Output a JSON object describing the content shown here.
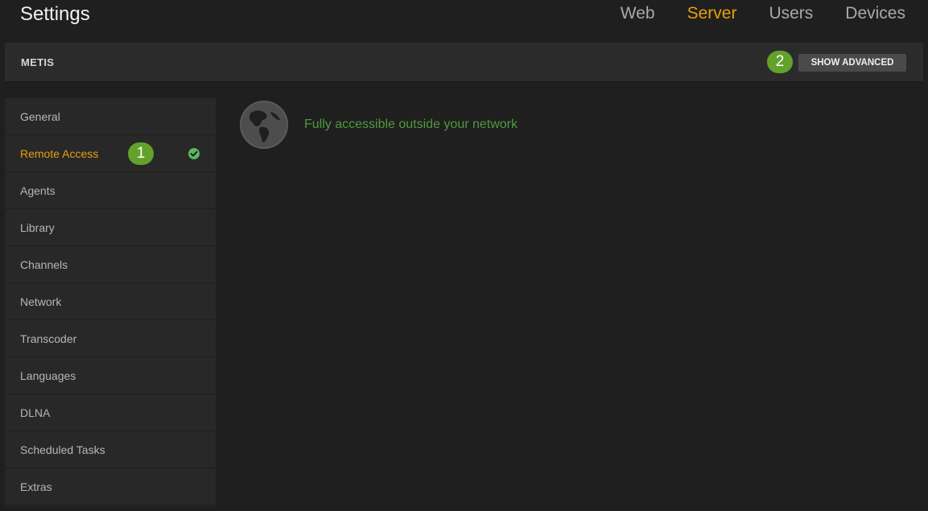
{
  "header": {
    "title": "Settings",
    "tabs": [
      {
        "label": "Web"
      },
      {
        "label": "Server"
      },
      {
        "label": "Users"
      },
      {
        "label": "Devices"
      }
    ],
    "active_tab": "Server"
  },
  "server_bar": {
    "name": "METIS",
    "step_badge": "2",
    "show_advanced_label": "SHOW ADVANCED"
  },
  "sidebar": {
    "items": [
      {
        "label": "General"
      },
      {
        "label": "Remote Access",
        "badge": "1",
        "status": "check-circle-icon"
      },
      {
        "label": "Agents"
      },
      {
        "label": "Library"
      },
      {
        "label": "Channels"
      },
      {
        "label": "Network"
      },
      {
        "label": "Transcoder"
      },
      {
        "label": "Languages"
      },
      {
        "label": "DLNA"
      },
      {
        "label": "Scheduled Tasks"
      },
      {
        "label": "Extras"
      }
    ],
    "active_item": "Remote Access"
  },
  "main": {
    "status_icon": "globe-icon",
    "status_text": "Fully accessible outside your network"
  },
  "colors": {
    "accent": "#e5a00d",
    "success": "#4f9a3a",
    "badge": "#62a22b",
    "background": "#1f1f1f"
  }
}
